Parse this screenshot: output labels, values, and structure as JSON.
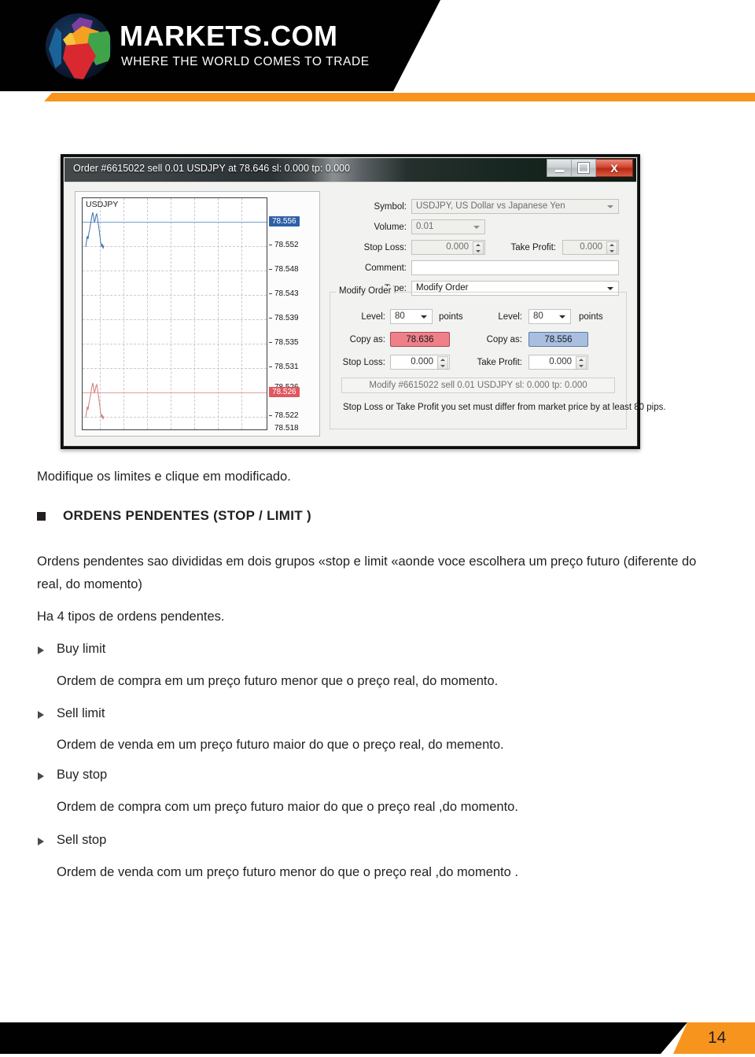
{
  "brand": {
    "wordmark": "MARKETS.COM",
    "tagline": "WHERE THE WORLD COMES TO TRADE",
    "accent_orange": "#f7941e",
    "black": "#010101"
  },
  "screenshot": {
    "window_title": "Order #6615022 sell 0.01 USDJPY at 78.646 sl: 0.000 tp: 0.000",
    "window_controls": {
      "minimize": "minimize",
      "maximize": "maximize",
      "close": "X"
    },
    "chart": {
      "symbol_label": "USDJPY",
      "ask_badge": "78.556",
      "bid_badge": "78.526",
      "ticks": [
        "78.556",
        "78.552",
        "78.548",
        "78.543",
        "78.539",
        "78.535",
        "78.531",
        "78.526",
        "78.522",
        "78.518"
      ]
    },
    "form": {
      "symbol_label": "Symbol:",
      "symbol_value": "USDJPY, US Dollar vs Japanese Yen",
      "volume_label": "Volume:",
      "volume_value": "0.01",
      "stop_loss_label": "Stop Loss:",
      "stop_loss_value": "0.000",
      "take_profit_label": "Take Profit:",
      "take_profit_value": "0.000",
      "comment_label": "Comment:",
      "comment_value": "",
      "type_label": "Type:",
      "type_value": "Modify Order"
    },
    "modify_group": {
      "group_title": "Modify Order",
      "left": {
        "level_label": "Level:",
        "level_value": "80",
        "points_label": "points",
        "copy_as_label": "Copy as:",
        "copy_as_value": "78.636",
        "field_label": "Stop Loss:",
        "field_value": "0.000"
      },
      "right": {
        "level_label": "Level:",
        "level_value": "80",
        "points_label": "points",
        "copy_as_label": "Copy as:",
        "copy_as_value": "78.556",
        "field_label": "Take Profit:",
        "field_value": "0.000"
      },
      "modify_button": "Modify  #6615022 sell 0.01 USDJPY sl: 0.000 tp: 0.000",
      "warning": "Stop Loss or Take Profit you set must differ from market price by at least 80 pips."
    }
  },
  "document": {
    "caption": "Modifique os limites e clique em modificado.",
    "heading": "ORDENS PENDENTES (STOP / LIMIT )",
    "intro": "Ordens pendentes sao divididas em dois grupos «stop e limit «aonde voce escolhera um preço futuro (diferente do real, do momento)",
    "count_line": "Ha 4 tipos de ordens pendentes.",
    "order_types": [
      {
        "title": "Buy limit",
        "description": "Ordem de compra em um preço futuro menor que o preço real, do momento."
      },
      {
        "title": "Sell limit",
        "description": "Ordem de venda em um preço futuro maior do que o preço real, do memento."
      },
      {
        "title": "Buy stop",
        "description": "Ordem de compra com um preço futuro maior do que o preço real ,do momento."
      },
      {
        "title": "Sell stop",
        "description": "Ordem de venda com um preço futuro menor do que o preço real ,do momento ."
      }
    ]
  },
  "footer": {
    "page_number": "14"
  }
}
